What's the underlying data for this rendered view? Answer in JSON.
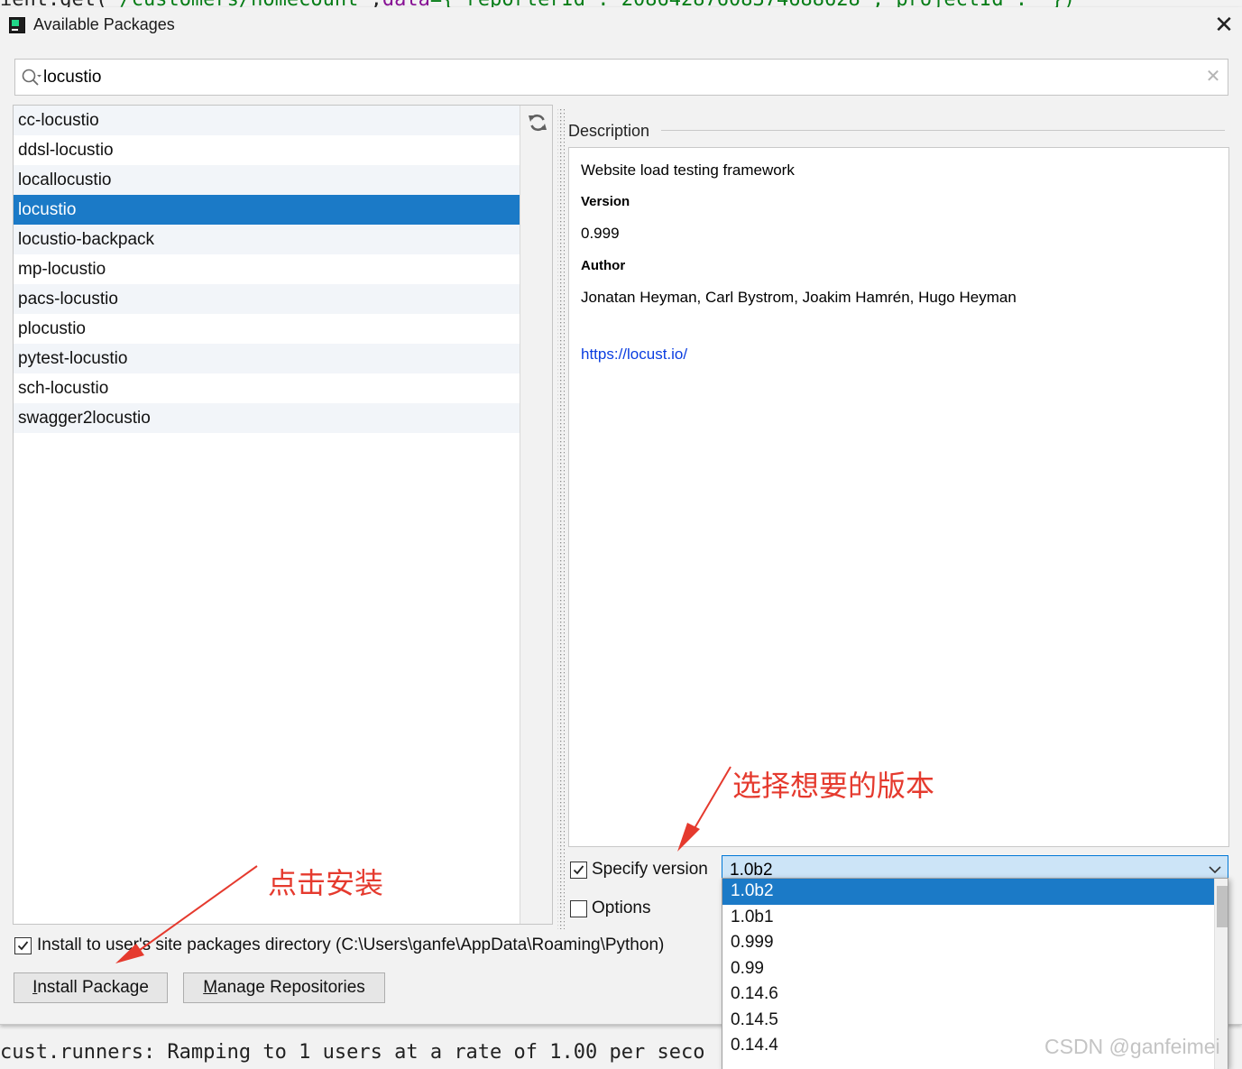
{
  "background": {
    "code_top": {
      "prefix": "ient.get(",
      "path": "'/customers/homecount'",
      "sep": ",",
      "kw": "data",
      "rest": "={'reporterId':'20864287608374688628','projectId':''})"
    },
    "console_bottom": "cust.runners: Ramping to 1 users at a rate of 1.00 per seco"
  },
  "dialog": {
    "title": "Available Packages",
    "close_icon": "close-icon"
  },
  "search": {
    "value": "locustio",
    "icon": "search-icon",
    "clear_icon": "clear-icon"
  },
  "packages": [
    "cc-locustio",
    "ddsl-locustio",
    "locallocustio",
    "locustio",
    "locustio-backpack",
    "mp-locustio",
    "pacs-locustio",
    "plocustio",
    "pytest-locustio",
    "sch-locustio",
    "swagger2locustio"
  ],
  "selected_package_index": 3,
  "description": {
    "header": "Description",
    "summary": "Website load testing framework",
    "version_label": "Version",
    "version": "0.999",
    "author_label": "Author",
    "author": "Jonatan Heyman, Carl Bystrom, Joakim Hamrén, Hugo Heyman",
    "link": "https://locust.io/"
  },
  "specify_version": {
    "label": "Specify version",
    "checked": true,
    "selected": "1.0b2",
    "options": [
      "1.0b2",
      "1.0b1",
      "0.999",
      "0.99",
      "0.14.6",
      "0.14.5",
      "0.14.4"
    ]
  },
  "options": {
    "label": "Options",
    "checked": false
  },
  "install_to_user": {
    "label": "Install to user's site packages directory (C:\\Users\\ganfe\\AppData\\Roaming\\Python)",
    "checked": true
  },
  "buttons": {
    "install_first": "I",
    "install_rest": "nstall Package",
    "manage_first": "M",
    "manage_rest": "anage Repositories"
  },
  "annotations": {
    "select_version": "选择想要的版本",
    "click_install": "点击安装"
  },
  "watermark": "CSDN @ganfeimei",
  "colors": {
    "selection": "#1b7ac7",
    "annotation": "#e53a2e",
    "link": "#0a3de0"
  }
}
